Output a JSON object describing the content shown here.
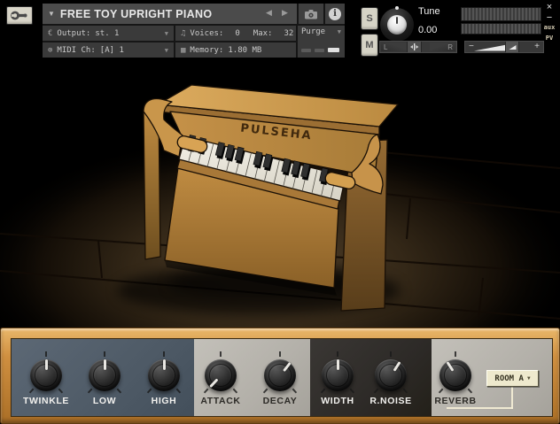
{
  "header": {
    "title": "FREE TOY UPRIGHT PIANO",
    "title_dropdown": "▼",
    "nav_prev": "◀",
    "nav_next": "▶",
    "info_glyph": "i",
    "output": {
      "label": "Output:",
      "value": "st. 1"
    },
    "voices": {
      "label": "Voices:",
      "value": "0"
    },
    "max": {
      "label": "Max:",
      "value": "32"
    },
    "midi": {
      "label": "MIDI Ch:",
      "value": "[A] 1"
    },
    "memory": {
      "label": "Memory:",
      "value": "1.80 MB"
    },
    "purge": {
      "label": "Purge",
      "caret": "▼"
    },
    "icons": {
      "output": "€",
      "voices": "♫",
      "midi": "⊚",
      "memory": "▦"
    },
    "solo": "S",
    "mute": "M",
    "tune": {
      "label": "Tune",
      "value": "0.00"
    },
    "pan": {
      "left": "L",
      "right": "R"
    },
    "volume": {
      "minus": "−",
      "plus": "+"
    },
    "window_controls": {
      "close": "×",
      "minimize": "−",
      "aux": "aux",
      "pv": "PV"
    }
  },
  "stage": {
    "brand": "PULSEHA"
  },
  "panel": {
    "knobs": [
      {
        "id": "twinkle",
        "label": "TWINKLE",
        "angle": 0,
        "section": "tone"
      },
      {
        "id": "low",
        "label": "LOW",
        "angle": 0,
        "section": "tone"
      },
      {
        "id": "high",
        "label": "HIGH",
        "angle": 0,
        "section": "tone"
      },
      {
        "id": "attack",
        "label": "ATTACK",
        "angle": -137,
        "section": "envelope"
      },
      {
        "id": "decay",
        "label": "DECAY",
        "angle": 38,
        "section": "envelope"
      },
      {
        "id": "width",
        "label": "WIDTH",
        "angle": 0,
        "section": "space"
      },
      {
        "id": "rnoise",
        "label": "R.NOISE",
        "angle": 33,
        "section": "space"
      },
      {
        "id": "reverb",
        "label": "REVERB",
        "angle": -33,
        "section": "reverb"
      }
    ],
    "reverb_select": {
      "value": "ROOM A",
      "caret": "▼"
    }
  },
  "colors": {
    "titlebar": "#4b4b4b",
    "header_cell": "#3a3a3a",
    "section_blue": "#4e5a66",
    "section_light": "#b3b0a9",
    "section_dark": "#2d2a27",
    "knob_pointer": "#e9e7e2",
    "dropdown_bg": "#eee9cd",
    "wood_frame": "#cf8f40",
    "piano_wood": "#c69245"
  }
}
